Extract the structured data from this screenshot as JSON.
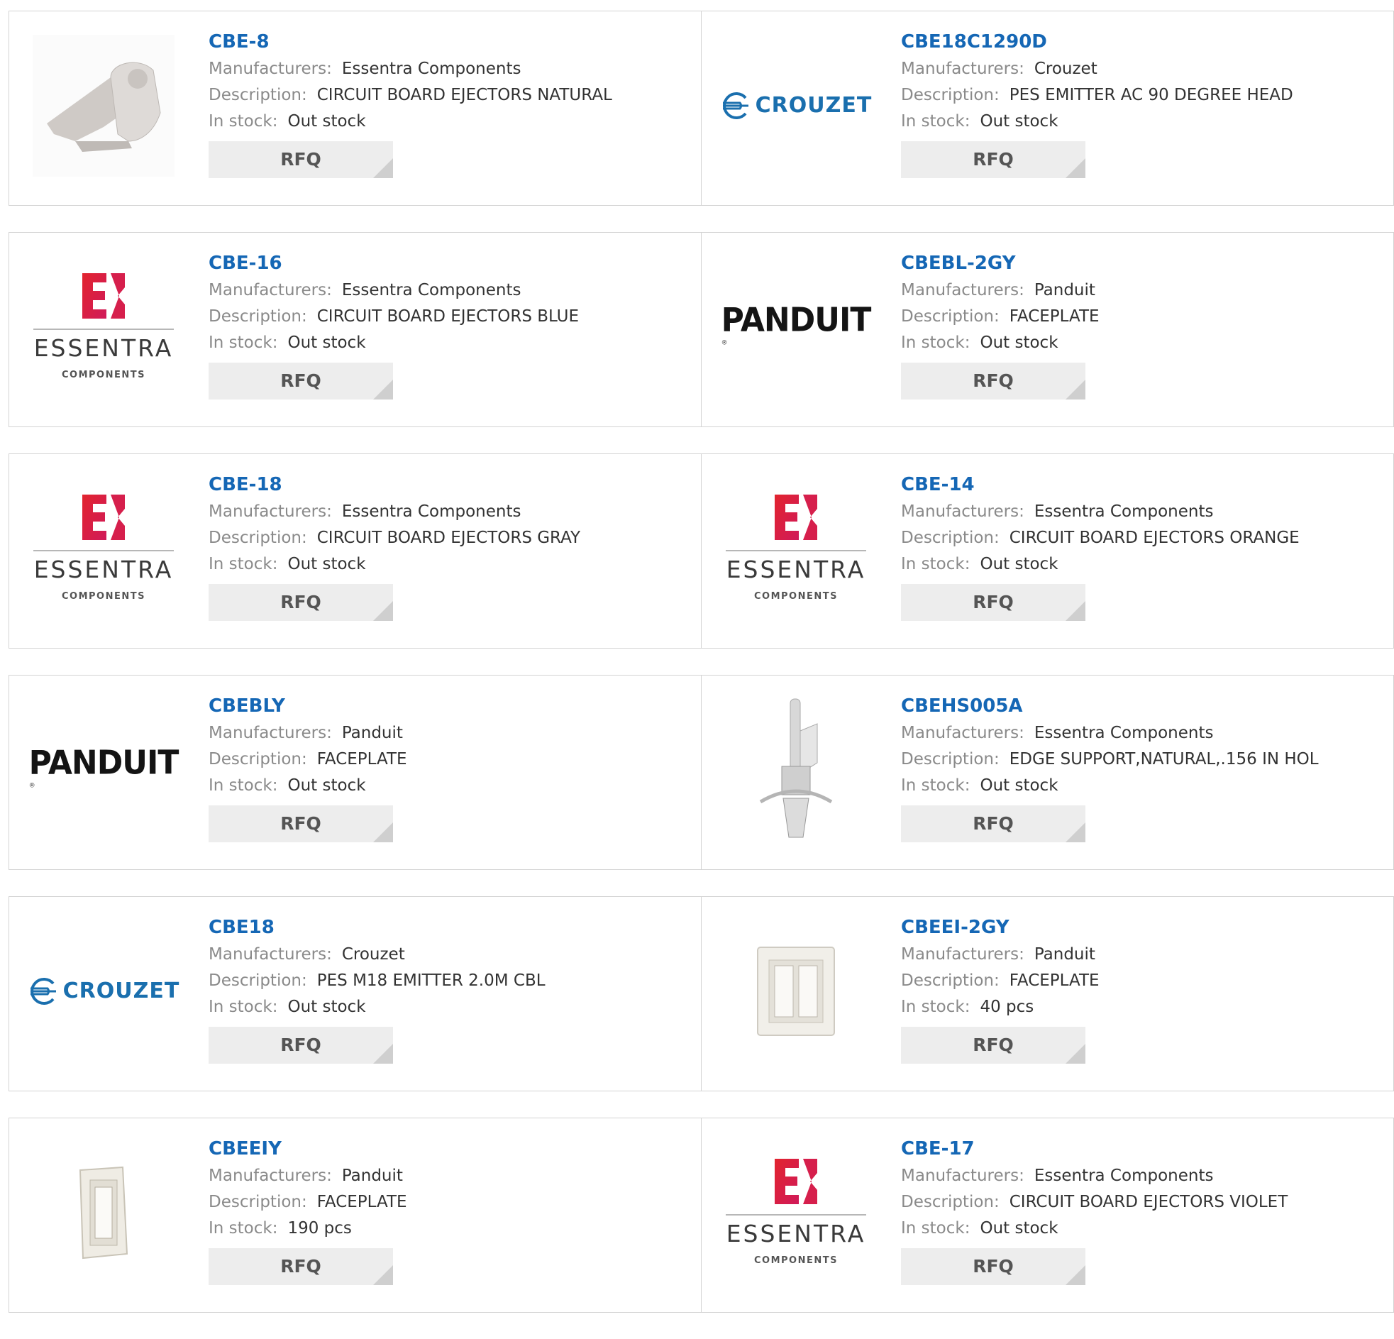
{
  "labels": {
    "manufacturers": "Manufacturers:",
    "description": "Description:",
    "in_stock": "In stock:",
    "rfq": "RFQ"
  },
  "logos": {
    "essentra_word": "ESSENTRA",
    "essentra_sub": "COMPONENTS",
    "crouzet_word": "CROUZET",
    "panduit_word": "PANDUIT"
  },
  "colors": {
    "part_link": "#1567b5",
    "label": "#8a8a8a",
    "value": "#333333",
    "button_bg": "#ededed"
  },
  "products": [
    {
      "part": "CBE-8",
      "manufacturer": "Essentra Components",
      "description": "CIRCUIT BOARD EJECTORS NATURAL",
      "stock": "Out stock",
      "image": "ejector-part-photo"
    },
    {
      "part": "CBE18C1290D",
      "manufacturer": "Crouzet",
      "description": "PES EMITTER AC 90 DEGREE HEAD",
      "stock": "Out stock",
      "image": "crouzet-logo"
    },
    {
      "part": "CBE-16",
      "manufacturer": "Essentra Components",
      "description": "CIRCUIT BOARD EJECTORS BLUE",
      "stock": "Out stock",
      "image": "essentra-logo"
    },
    {
      "part": "CBEBL-2GY",
      "manufacturer": "Panduit",
      "description": "FACEPLATE",
      "stock": "Out stock",
      "image": "panduit-logo"
    },
    {
      "part": "CBE-18",
      "manufacturer": "Essentra Components",
      "description": "CIRCUIT BOARD EJECTORS GRAY",
      "stock": "Out stock",
      "image": "essentra-logo"
    },
    {
      "part": "CBE-14",
      "manufacturer": "Essentra Components",
      "description": "CIRCUIT BOARD EJECTORS ORANGE",
      "stock": "Out stock",
      "image": "essentra-logo"
    },
    {
      "part": "CBEBLY",
      "manufacturer": "Panduit",
      "description": "FACEPLATE",
      "stock": "Out stock",
      "image": "panduit-logo"
    },
    {
      "part": "CBEHS005A",
      "manufacturer": "Essentra Components",
      "description": "EDGE SUPPORT,NATURAL,.156 IN HOL",
      "stock": "Out stock",
      "image": "edge-support-photo"
    },
    {
      "part": "CBE18",
      "manufacturer": "Crouzet",
      "description": "PES M18 EMITTER 2.0M CBL",
      "stock": "Out stock",
      "image": "crouzet-logo"
    },
    {
      "part": "CBEEI-2GY",
      "manufacturer": "Panduit",
      "description": "FACEPLATE",
      "stock": "40 pcs",
      "image": "double-faceplate-photo"
    },
    {
      "part": "CBEEIY",
      "manufacturer": "Panduit",
      "description": "FACEPLATE",
      "stock": "190 pcs",
      "image": "single-faceplate-photo"
    },
    {
      "part": "CBE-17",
      "manufacturer": "Essentra Components",
      "description": "CIRCUIT BOARD EJECTORS VIOLET",
      "stock": "Out stock",
      "image": "essentra-logo"
    }
  ]
}
